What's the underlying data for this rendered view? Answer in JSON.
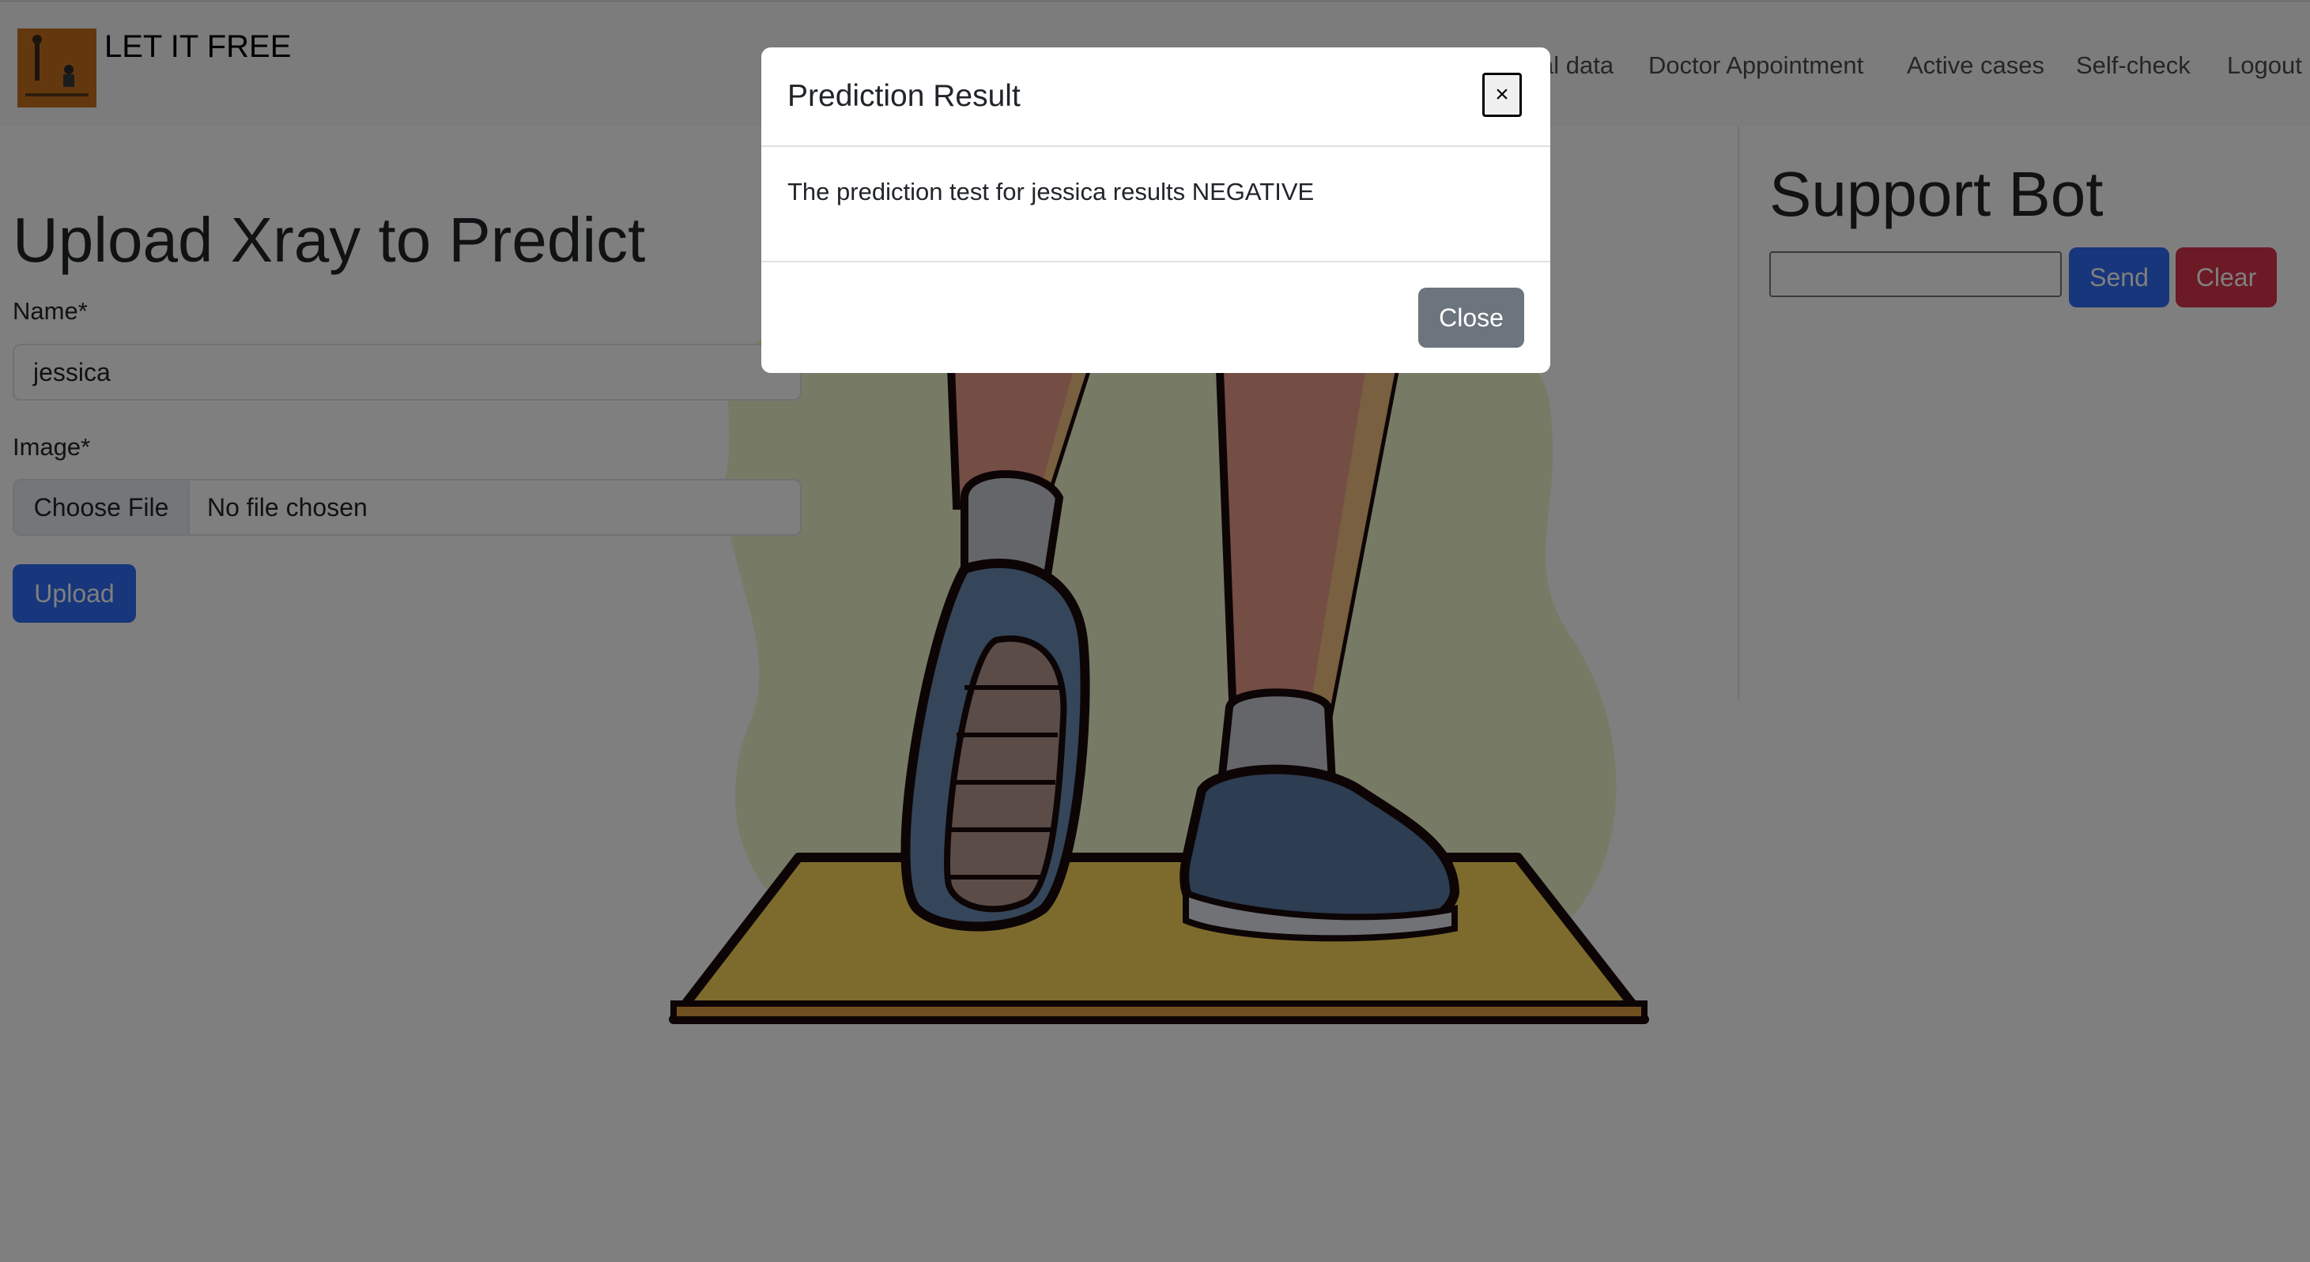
{
  "navbar": {
    "brand": "LET IT FREE",
    "links": [
      {
        "label": "al data"
      },
      {
        "label": "Doctor Appointment"
      },
      {
        "label": "Active cases"
      },
      {
        "label": "Self-check"
      },
      {
        "label": "Logout"
      }
    ]
  },
  "upload_form": {
    "title": "Upload Xray to Predict",
    "name_label": "Name*",
    "name_value": "jessica",
    "image_label": "Image*",
    "file_button": "Choose File",
    "file_status": "No file chosen",
    "submit_label": "Upload"
  },
  "support_bot": {
    "title": "Support Bot",
    "input_value": "",
    "send_label": "Send",
    "clear_label": "Clear"
  },
  "modal": {
    "title": "Prediction Result",
    "close_x": "×",
    "message": "The prediction test for jessica results NEGATIVE",
    "close_label": "Close"
  },
  "colors": {
    "primary": "#2f6df6",
    "danger": "#d9354a",
    "secondary": "#6c757d",
    "backdrop": "rgba(0,0,0,0.5)"
  }
}
